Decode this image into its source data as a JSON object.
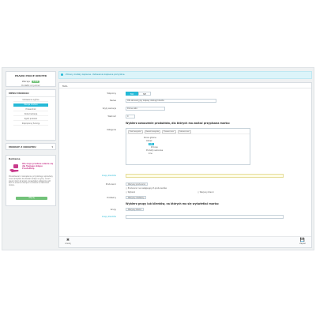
{
  "sidebar": {
    "module_title": "PRAWO PROCE KMOTER",
    "version_label": "Wersja",
    "version_value": "1.0.0",
    "module_sub": "Dodatki od juriner",
    "menu_title": "MENU MODUŁU",
    "menu_items": [
      "Ustawienia ogólne",
      "Wersja modułu",
      "Przewodnik",
      "Dokumentacja",
      "Zgłoś problem",
      "Zaproponuj funkcję"
    ],
    "menu_active_index": 1,
    "other_title": "MODUŁY Z DODATKU",
    "other_icon": "chevron-down-icon",
    "promo_title": "Reklama",
    "promo_heading": "Ofe moje prostsze udarza się dla Twojego sklepu PrestaShop",
    "promo_text": "Przedstawiam rozwiązania, przydatnego sprzedaży oraz narzędzia dla działań sklepu w górę. Lorem ipsum dolor sit amet, consectetur adipiscing elit sed do eiusmod tempor incididunt ut labore et dolore.",
    "promo_button": "Więcej"
  },
  "main": {
    "alert": "Zmiany zostały zapisane. Ustawienia zapisane pomyślnie.",
    "card_title": "MAIL",
    "form": {
      "enabled_label": "Włączony",
      "toggle_yes": "TAK",
      "toggle_no": "NIE",
      "name_label": "Nazwa",
      "name_value": "Ofe akcesoryjny zapasy obsługi klienta",
      "variant_label": "Szyty wariacja",
      "variant_value": "Dolne Lato",
      "priority_label": "Ważność",
      "priority_value": "0",
      "section_products": "Wybierz oznaczenie produktów, dla których ma zostać przypisana marka:",
      "categories_label": "Kategorie",
      "tree_toolbar": [
        "Zwiń wszystko",
        "Rozwiń wszystko",
        "Zaznacz wsz.",
        "Odznacz wsz."
      ],
      "tree_nodes": [
        "Strona główna",
        "Odzież",
        "Lato",
        "Zimowe",
        "Produkty sezonowe",
        "Inne"
      ],
      "tree_selected_index": 2,
      "customer_groups_label": "Grupy klientów",
      "customer_groups_value": "",
      "producers_label": "Producenci",
      "producers_btn": "Wszyscy producenci",
      "producers_options": [
        "Producenci na następujących producentów",
        "Wybierz",
        "Wszyscy klienci"
      ],
      "producers_right": "Wszyscy klienci",
      "suppliers_label": "Dostawcy",
      "suppliers_btn": "Wszyscy dostawcy",
      "section_groups": "Wybierz grupy lub klientów, na których ma się wyświetlać marka:",
      "groups_label": "Grupy",
      "groups_btn": "Wszyscy klienci",
      "customers_label": "Grupy klientów",
      "customers_value": ""
    },
    "footer": {
      "cancel_label": "Anuluj",
      "save_label": "Zapisz"
    }
  }
}
